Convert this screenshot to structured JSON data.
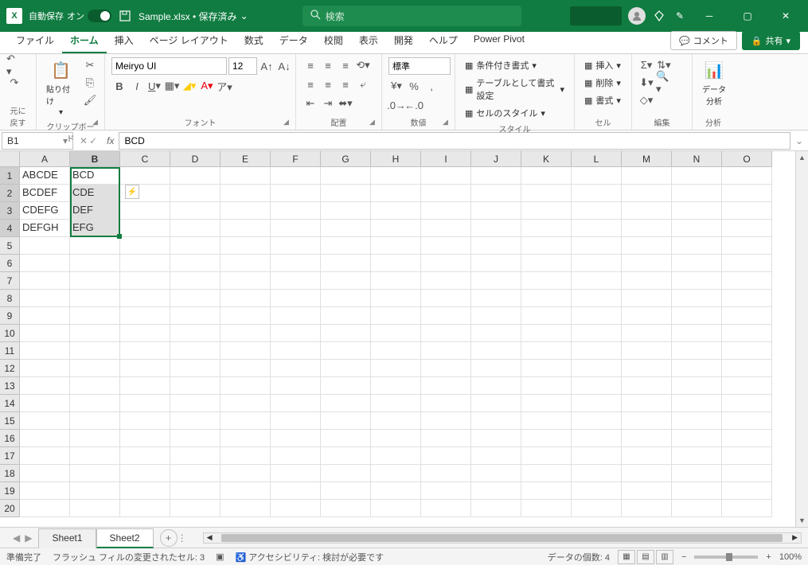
{
  "titlebar": {
    "autosave_label": "自動保存",
    "autosave_state": "オン",
    "filename": "Sample.xlsx • 保存済み",
    "search_placeholder": "検索"
  },
  "tabs": {
    "items": [
      "ファイル",
      "ホーム",
      "挿入",
      "ページ レイアウト",
      "数式",
      "データ",
      "校閲",
      "表示",
      "開発",
      "ヘルプ",
      "Power Pivot"
    ],
    "active": 1,
    "comment_btn": "コメント",
    "share_btn": "共有"
  },
  "ribbon": {
    "undo_group": "元に戻す",
    "clipboard_group": "クリップボード",
    "paste_label": "貼り付け",
    "font_group": "フォント",
    "font_name": "Meiryo UI",
    "font_size": "12",
    "align_group": "配置",
    "number_group": "数値",
    "number_format": "標準",
    "styles_group": "スタイル",
    "cond_format": "条件付き書式",
    "table_format": "テーブルとして書式設定",
    "cell_styles": "セルのスタイル",
    "cells_group": "セル",
    "insert_label": "挿入",
    "delete_label": "削除",
    "format_label": "書式",
    "edit_group": "編集",
    "analysis_group": "分析",
    "data_analysis": "データ\n分析"
  },
  "formula_bar": {
    "name_box": "B1",
    "formula": "BCD"
  },
  "columns": [
    "A",
    "B",
    "C",
    "D",
    "E",
    "F",
    "G",
    "H",
    "I",
    "J",
    "K",
    "L",
    "M",
    "N",
    "O"
  ],
  "rows": 20,
  "cells": {
    "A1": "ABCDE",
    "A2": "BCDEF",
    "A3": "CDEFG",
    "A4": "DEFGH",
    "B1": "BCD",
    "B2": "CDE",
    "B3": "DEF",
    "B4": "EFG"
  },
  "selection": {
    "col": "B",
    "row_start": 1,
    "row_end": 4,
    "fill_rows": [
      2,
      3,
      4
    ]
  },
  "sheets": {
    "items": [
      "Sheet1",
      "Sheet2"
    ],
    "active": 1
  },
  "status": {
    "ready": "準備完了",
    "flash": "フラッシュ フィルの変更されたセル: 3",
    "access": "アクセシビリティ: 検討が必要です",
    "count": "データの個数: 4",
    "zoom": "100%"
  }
}
